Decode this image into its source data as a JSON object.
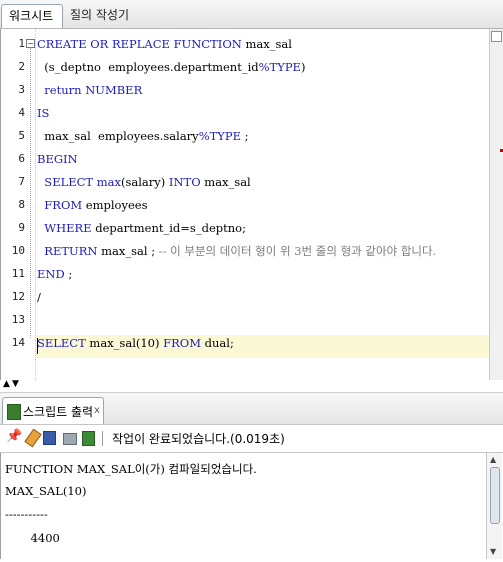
{
  "tabs": {
    "worksheet": "워크시트",
    "query_builder": "질의 작성기"
  },
  "editor": {
    "line_numbers": [
      "1",
      "2",
      "3",
      "4",
      "5",
      "6",
      "7",
      "8",
      "9",
      "10",
      "11",
      "12",
      "13",
      "14"
    ],
    "lines": [
      [
        {
          "t": "CREATE OR REPLACE FUNCTION",
          "c": "kw"
        },
        {
          "t": " max_sal",
          "c": ""
        }
      ],
      [
        {
          "t": "  (s_deptno  employees.department_id",
          "c": ""
        },
        {
          "t": "%TYPE",
          "c": "kw"
        },
        {
          "t": ")",
          "c": ""
        }
      ],
      [
        {
          "t": "  return NUMBER",
          "c": "kw"
        }
      ],
      [
        {
          "t": "IS",
          "c": "kw"
        }
      ],
      [
        {
          "t": "  max_sal  employees.salary",
          "c": ""
        },
        {
          "t": "%TYPE",
          "c": "kw"
        },
        {
          "t": " ;",
          "c": ""
        }
      ],
      [
        {
          "t": "BEGIN",
          "c": "kw"
        }
      ],
      [
        {
          "t": "  SELECT max",
          "c": "kw"
        },
        {
          "t": "(salary) ",
          "c": ""
        },
        {
          "t": "INTO",
          "c": "kw"
        },
        {
          "t": " max_sal",
          "c": ""
        }
      ],
      [
        {
          "t": "  FROM",
          "c": "kw"
        },
        {
          "t": " employees",
          "c": ""
        }
      ],
      [
        {
          "t": "  WHERE",
          "c": "kw"
        },
        {
          "t": " department_id=s_deptno;",
          "c": ""
        }
      ],
      [
        {
          "t": "  RETURN",
          "c": "kw"
        },
        {
          "t": " max_sal ; ",
          "c": ""
        },
        {
          "t": "-- 이 부분의 데이터 형이 위 3번 줄의 형과 같아야 합니다.",
          "c": "cm"
        }
      ],
      [
        {
          "t": "END",
          "c": "kw"
        },
        {
          "t": " ;",
          "c": ""
        }
      ],
      [
        {
          "t": "/",
          "c": ""
        }
      ],
      [
        {
          "t": "",
          "c": ""
        }
      ],
      [
        {
          "t": "SELECT",
          "c": "kw"
        },
        {
          "t": " max_sal(10) ",
          "c": ""
        },
        {
          "t": "FROM",
          "c": "kw"
        },
        {
          "t": " dual;",
          "c": ""
        }
      ]
    ]
  },
  "panel": {
    "tab_label": "스크립트 출력",
    "close": "x",
    "status": "작업이 완료되었습니다.(0.019초)"
  },
  "output": {
    "lines": [
      "FUNCTION MAX_SAL이(가) 컴파일되었습니다.",
      "MAX_SAL(10)",
      "-----------",
      "       4400"
    ]
  },
  "colors": {
    "keyword": "#1d1dbf",
    "comment": "#7c7c7c",
    "current_line": "#fbf8d6"
  }
}
